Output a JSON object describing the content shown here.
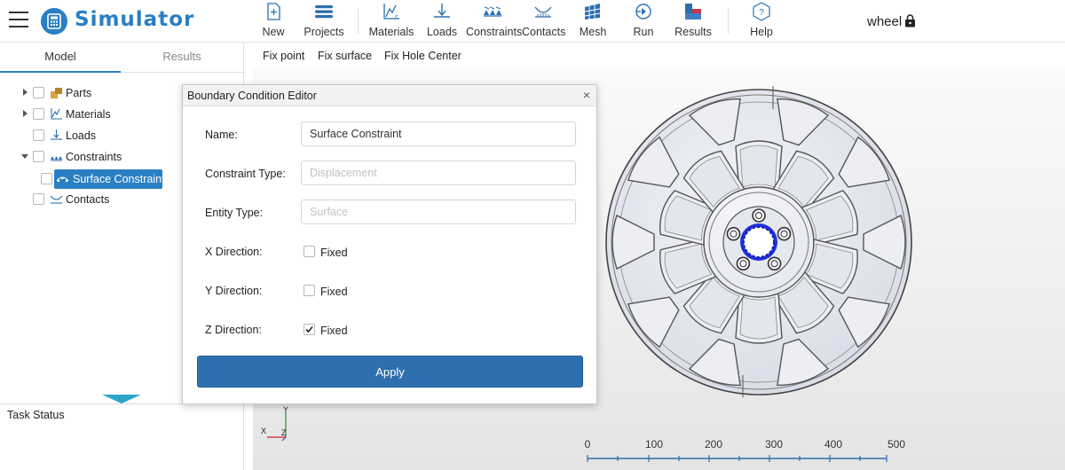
{
  "header": {
    "app_title": "Simulator",
    "project_name": "wheel",
    "accent_color": "#2a7fc4",
    "toolbar": [
      {
        "label": "New",
        "icon": "new-file-icon"
      },
      {
        "label": "Projects",
        "icon": "projects-icon"
      },
      {
        "label": "Materials",
        "icon": "materials-icon"
      },
      {
        "label": "Loads",
        "icon": "loads-icon"
      },
      {
        "label": "Constraints",
        "icon": "constraints-icon"
      },
      {
        "label": "Contacts",
        "icon": "contacts-icon"
      },
      {
        "label": "Mesh",
        "icon": "mesh-icon"
      },
      {
        "label": "Run",
        "icon": "run-icon"
      },
      {
        "label": "Results",
        "icon": "results-icon"
      },
      {
        "label": "Help",
        "icon": "help-icon"
      }
    ]
  },
  "left_panel": {
    "tabs": [
      "Model",
      "Results"
    ],
    "active_tab": "Model",
    "tree": [
      {
        "label": "Parts",
        "expandable": true,
        "expanded": false
      },
      {
        "label": "Materials",
        "expandable": true,
        "expanded": false
      },
      {
        "label": "Loads",
        "expandable": false
      },
      {
        "label": "Constraints",
        "expandable": true,
        "expanded": true
      },
      {
        "label": "Surface Constraint",
        "child": true,
        "selected": true
      },
      {
        "label": "Contacts",
        "expandable": false
      }
    ],
    "task_status_label": "Task Status"
  },
  "subbar": {
    "buttons": [
      "Fix point",
      "Fix surface",
      "Fix Hole Center"
    ]
  },
  "dialog": {
    "title": "Boundary Condition Editor",
    "close_glyph": "×",
    "fields": {
      "name": {
        "label": "Name:",
        "value": "Surface Constraint"
      },
      "constraint_type": {
        "label": "Constraint Type:",
        "placeholder": "Displacement"
      },
      "entity_type": {
        "label": "Entity Type:",
        "placeholder": "Surface"
      }
    },
    "directions": [
      {
        "label": "X Direction:",
        "option": "Fixed",
        "checked": false
      },
      {
        "label": "Y Direction:",
        "option": "Fixed",
        "checked": false
      },
      {
        "label": "Z Direction:",
        "option": "Fixed",
        "checked": true
      }
    ],
    "apply_label": "Apply"
  },
  "viewport": {
    "axes": {
      "x": "X",
      "y": "Y",
      "z": "Z"
    },
    "scale_ticks": [
      "0",
      "100",
      "200",
      "300",
      "400",
      "500"
    ]
  }
}
